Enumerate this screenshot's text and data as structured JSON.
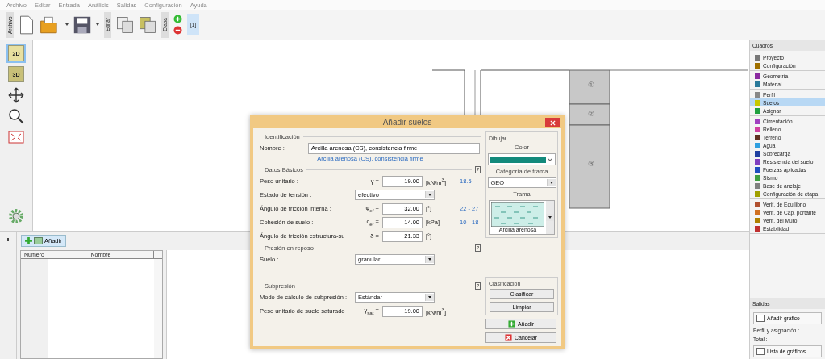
{
  "menu": [
    "Archivo",
    "Editar",
    "Entrada",
    "Análisis",
    "Salidas",
    "Configuración",
    "Ayuda"
  ],
  "toolbar": {
    "groups": [
      "Archivo",
      "Editar",
      "Etapa"
    ],
    "stage": "[1]"
  },
  "left_tools": [
    {
      "kind": "flat",
      "label": "2D",
      "selected": true
    },
    {
      "kind": "cube",
      "label": "3D",
      "selected": false
    },
    {
      "kind": "move",
      "selected": false
    },
    {
      "kind": "zoom",
      "selected": false
    },
    {
      "kind": "fit",
      "selected": false
    }
  ],
  "canvas": {
    "layers": [
      "①",
      "②",
      "③"
    ]
  },
  "bottom_panel": {
    "add_button": "Añadir",
    "columns": [
      "Número",
      "Nombre"
    ]
  },
  "dialog": {
    "title": "Añadir suelos",
    "identification": {
      "legend": "Identificación",
      "name_label": "Nombre :",
      "name_value": "Arcilla arenosa (CS), consistencia firme",
      "name_hint": "Arcilla arenosa (CS), consistencia firme"
    },
    "sections": [
      {
        "legend": "Datos Básicos",
        "help": "?",
        "rows": [
          {
            "kind": "input",
            "label": "Peso unitario :",
            "symbol": "γ =",
            "value": "19.00",
            "unit": "[kN/m$^{3}$]",
            "range": "18.5"
          },
          {
            "kind": "select",
            "label": "Estado de tensión :",
            "value": "efectivo"
          },
          {
            "kind": "input",
            "label": "Ángulo de fricción interna :",
            "symbol": "φ$_{ef}$ =",
            "value": "32.00",
            "unit": "[°]",
            "range": "22 - 27"
          },
          {
            "kind": "input",
            "label": "Cohesión de suelo :",
            "symbol": "c$_{ef}$ =",
            "value": "14.00",
            "unit": "[kPa]",
            "range": "10 - 18"
          },
          {
            "kind": "input",
            "label": "Ángulo de fricción estructura-su",
            "symbol": "δ =",
            "value": "21.33",
            "unit": "[°]"
          }
        ]
      },
      {
        "legend": "Presión en reposo",
        "help": "?",
        "rows": [
          {
            "kind": "select",
            "label": "Suelo :",
            "value": "granular"
          }
        ]
      },
      {
        "legend": "Subpresión",
        "help": "?",
        "rows": [
          {
            "kind": "select",
            "label": "Modo de cálculo de subpresión :",
            "value": "Estándar"
          },
          {
            "kind": "input",
            "label": "Peso unitario de suelo saturado",
            "symbol": "γ$_{sat}$ =",
            "value": "19.00",
            "unit": "[kN/m$^{3}$]"
          }
        ]
      }
    ],
    "draw": {
      "legend": "Dibujar",
      "color_label": "Color",
      "color": "#138a7c",
      "pattern_category_label": "Categoría de trama",
      "pattern_category": "GEO",
      "pattern_label": "Trama",
      "pattern_name": "Arcilla arenosa"
    },
    "classification": {
      "legend": "Clasificación",
      "buttons": [
        "Clasificar",
        "Limpiar"
      ]
    },
    "actions": [
      {
        "kind": "add",
        "label": "Añadir"
      },
      {
        "kind": "cancel",
        "label": "Cancelar"
      }
    ]
  },
  "sidebar": {
    "title": "Cuadros",
    "groups": [
      [
        {
          "label": "Proyecto",
          "selected": false
        },
        {
          "label": "Configuración",
          "selected": false
        }
      ],
      [
        {
          "label": "Geometría",
          "selected": false
        },
        {
          "label": "Material",
          "selected": false
        }
      ],
      [
        {
          "label": "Perfil",
          "selected": false
        },
        {
          "label": "Suelos",
          "selected": true
        },
        {
          "label": "Asignar",
          "selected": false
        }
      ],
      [
        {
          "label": "Cimentación",
          "selected": false
        },
        {
          "label": "Relleno",
          "selected": false
        },
        {
          "label": "Terreno",
          "selected": false
        },
        {
          "label": "Agua",
          "selected": false
        },
        {
          "label": "Sobrecarga",
          "selected": false
        },
        {
          "label": "Resistencia del suelo",
          "selected": false
        },
        {
          "label": "Fuerzas aplicadas",
          "selected": false
        },
        {
          "label": "Sismo",
          "selected": false
        },
        {
          "label": "Base de anclaje",
          "selected": false
        },
        {
          "label": "Configuración de etapa",
          "selected": false
        }
      ],
      [
        {
          "label": "Verif. de Equilibrio",
          "selected": false
        },
        {
          "label": "Verif. de Cap. portante",
          "selected": false
        },
        {
          "label": "Verif. del Muro",
          "selected": false
        },
        {
          "label": "Estabilidad",
          "selected": false
        }
      ]
    ],
    "outputs_title": "Salidas",
    "add_chart": "Añadir gráfico",
    "profile_label": "Perfil y asignación :",
    "total_label": "Total :",
    "chart_list": "Lista de gráficos"
  }
}
